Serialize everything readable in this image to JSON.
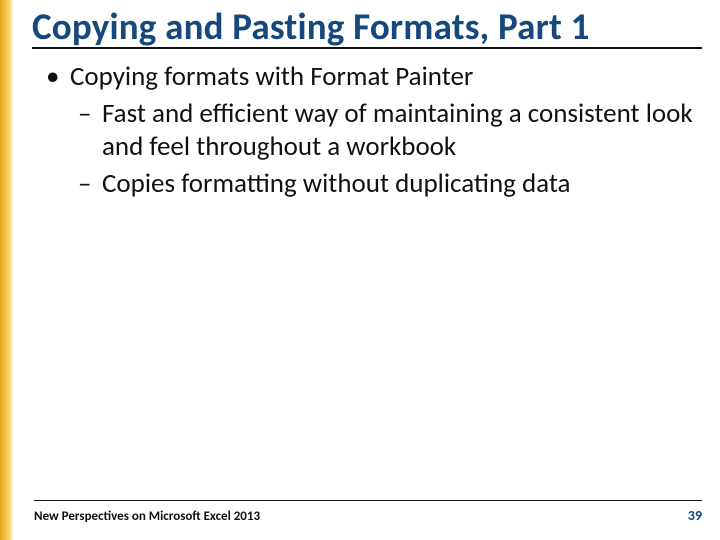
{
  "title": "Copying and Pasting Formats, Part 1",
  "bullet1": "Copying formats with Format Painter",
  "sub1": "Fast and efficient way of maintaining a consistent look and feel throughout a workbook",
  "sub2": "Copies formatting without duplicating data",
  "footer": {
    "left": "New Perspectives on Microsoft Excel 2013",
    "page": "39"
  }
}
